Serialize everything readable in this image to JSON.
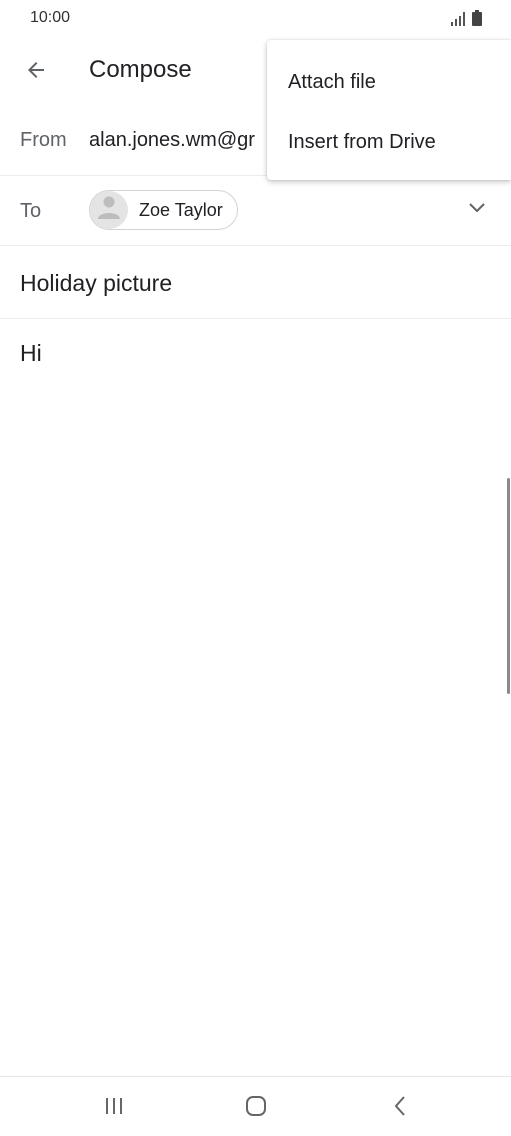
{
  "status_bar": {
    "time": "10:00",
    "icons": [
      "signal-icon",
      "battery-icon"
    ]
  },
  "app_bar": {
    "back_icon": "arrow-left-icon",
    "title": "Compose"
  },
  "from": {
    "label": "From",
    "value": "alan.jones.wm@gr"
  },
  "to": {
    "label": "To",
    "recipient": "Zoe Taylor",
    "avatar_icon": "person-icon",
    "expand_icon": "chevron-down-icon"
  },
  "subject": {
    "value": "Holiday picture"
  },
  "body": {
    "value": "Hi"
  },
  "menu": {
    "items": [
      {
        "label": "Attach file"
      },
      {
        "label": "Insert from Drive"
      }
    ]
  },
  "nav_bar": {
    "icons": [
      "recent-apps-icon",
      "home-icon",
      "back-icon"
    ]
  },
  "colors": {
    "text_primary": "#202124",
    "text_secondary": "#5f6368",
    "divider": "#ececec",
    "chip_border": "#d3d3d3",
    "avatar_bg": "#e4e4e4"
  }
}
